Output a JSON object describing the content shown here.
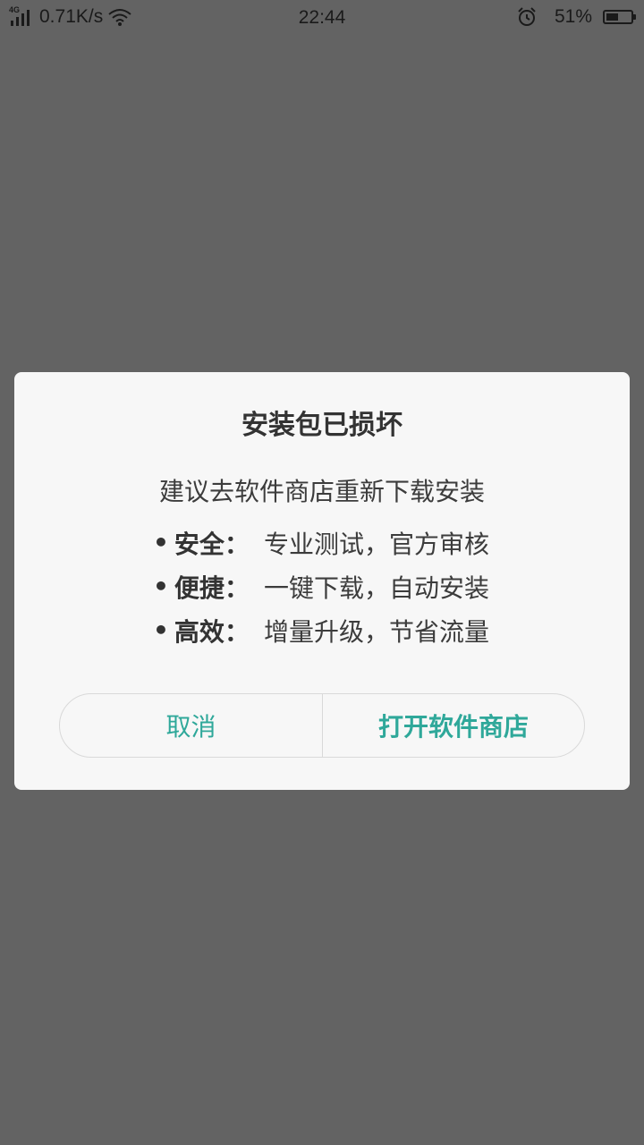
{
  "status_bar": {
    "network_type": "4G",
    "speed": "0.71K/s",
    "time": "22:44",
    "battery_percent_text": "51%",
    "battery_level": 0.51,
    "icons": [
      "signal-icon",
      "wifi-icon",
      "alarm-icon",
      "battery-icon"
    ]
  },
  "dialog": {
    "title": "安装包已损坏",
    "subtitle": "建议去软件商店重新下载安装",
    "benefits": [
      {
        "name": "安全",
        "separator": "：",
        "desc": "专业测试，官方审核"
      },
      {
        "name": "便捷",
        "separator": "：",
        "desc": "一键下载，自动安装"
      },
      {
        "name": "高效",
        "separator": "：",
        "desc": "增量升级，节省流量"
      }
    ],
    "bullet": "•",
    "cancel_label": "取消",
    "open_store_label": "打开软件商店"
  },
  "colors": {
    "overlay": "#636363",
    "dialog_bg": "#f7f7f7",
    "accent": "#2fa89a",
    "text": "#333333"
  }
}
